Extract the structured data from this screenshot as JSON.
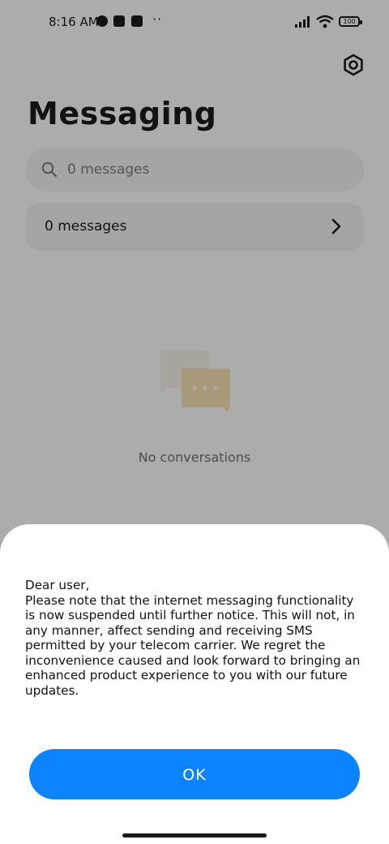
{
  "status_bar": {
    "time": "8:16 AM",
    "overflow": "··",
    "battery": "100"
  },
  "header": {
    "title": "Messaging",
    "settings_icon": "gear-icon"
  },
  "search": {
    "placeholder": "0 messages",
    "icon": "search-icon"
  },
  "messages_row": {
    "label": "0 messages",
    "icon": "chevron-right-icon"
  },
  "empty_state": {
    "icon": "chat-bubbles-icon",
    "text": "No conversations"
  },
  "dialog": {
    "message": "Dear user,\nPlease note that the internet messaging functionality is now suspended until further notice. This will not, in any manner, affect sending and receiving SMS permitted by your telecom carrier. We regret the inconvenience caused and look forward to bringing an enhanced product experience to you with our future updates.",
    "ok_label": "OK"
  },
  "colors": {
    "accent": "#0d84ff",
    "scrim": "rgba(0,0,0,0.30)"
  }
}
